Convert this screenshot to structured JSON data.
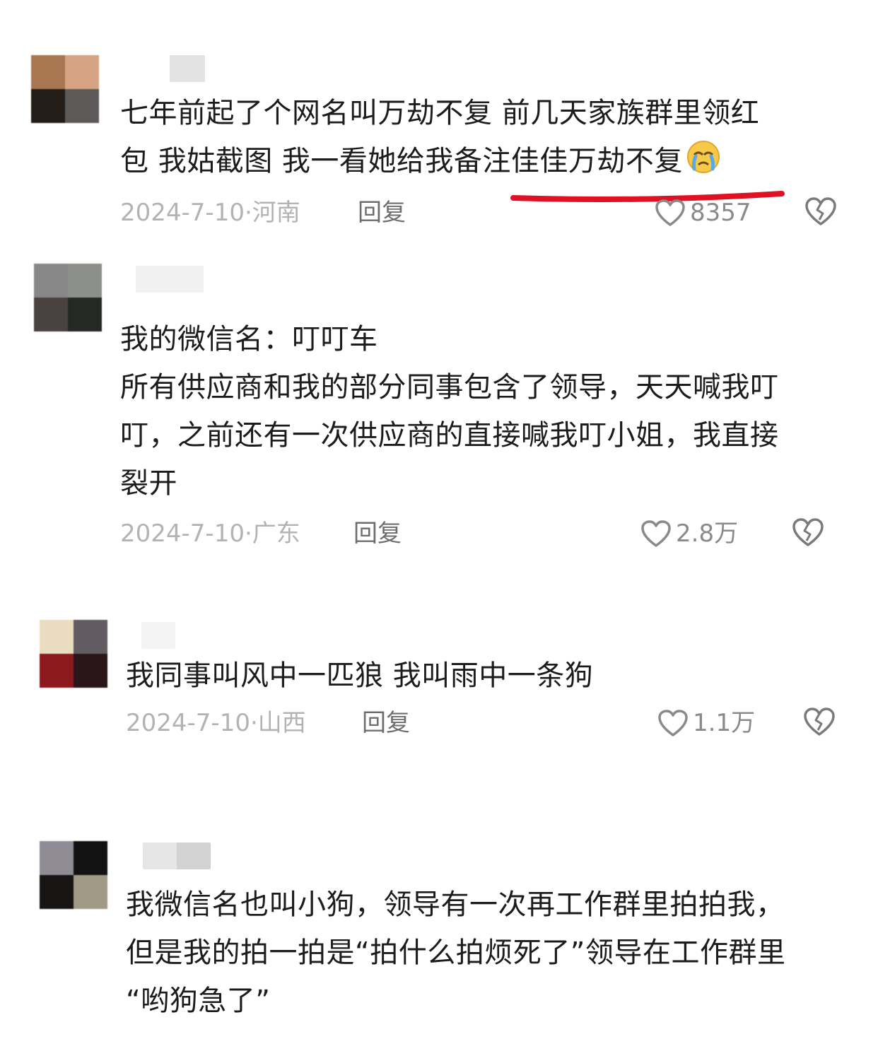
{
  "comments": [
    {
      "lines": [
        "七年前起了个网名叫万劫不复  前几天家族群里领红",
        "包 我姑截图 我一看她给我备注佳佳万劫不复"
      ],
      "emoji": "crying-face-emoji",
      "date": "2024-7-10",
      "sep": "·",
      "location": "河南",
      "reply": "回复",
      "likes": "8357",
      "avatar_colors": [
        "#a87650",
        "#d6a483",
        "#231c17",
        "#5c5a58"
      ]
    },
    {
      "lines": [
        "我的微信名：叮叮车",
        "所有供应商和我的部分同事包含了领导，天天喊我叮",
        "叮，之前还有一次供应商的直接喊我叮小姐，我直接",
        "裂开"
      ],
      "date": "2024-7-10",
      "sep": "·",
      "location": "广东",
      "reply": "回复",
      "likes": "2.8万",
      "avatar_colors": [
        "#878787",
        "#8d8f8b",
        "#4a4240",
        "#262824"
      ]
    },
    {
      "lines": [
        "我同事叫风中一匹狼 我叫雨中一条狗"
      ],
      "date": "2024-7-10",
      "sep": "·",
      "location": "山西",
      "reply": "回复",
      "likes": "1.1万",
      "avatar_colors": [
        "#e9dcc0",
        "#625c62",
        "#8c1a1d",
        "#2a1519"
      ]
    },
    {
      "lines": [
        "我微信名也叫小狗，领导有一次再工作群里拍拍我，",
        "但是我的拍一拍是“拍什么拍烦死了”领导在工作群里",
        "“哟狗急了”"
      ],
      "avatar_colors": [
        "#8f8c96",
        "#121212",
        "#171513",
        "#a09a86"
      ]
    }
  ],
  "colors": {
    "underline": "#e01025",
    "meta_gray": "#b3b3b3",
    "reply_gray": "#6e6e6e"
  }
}
